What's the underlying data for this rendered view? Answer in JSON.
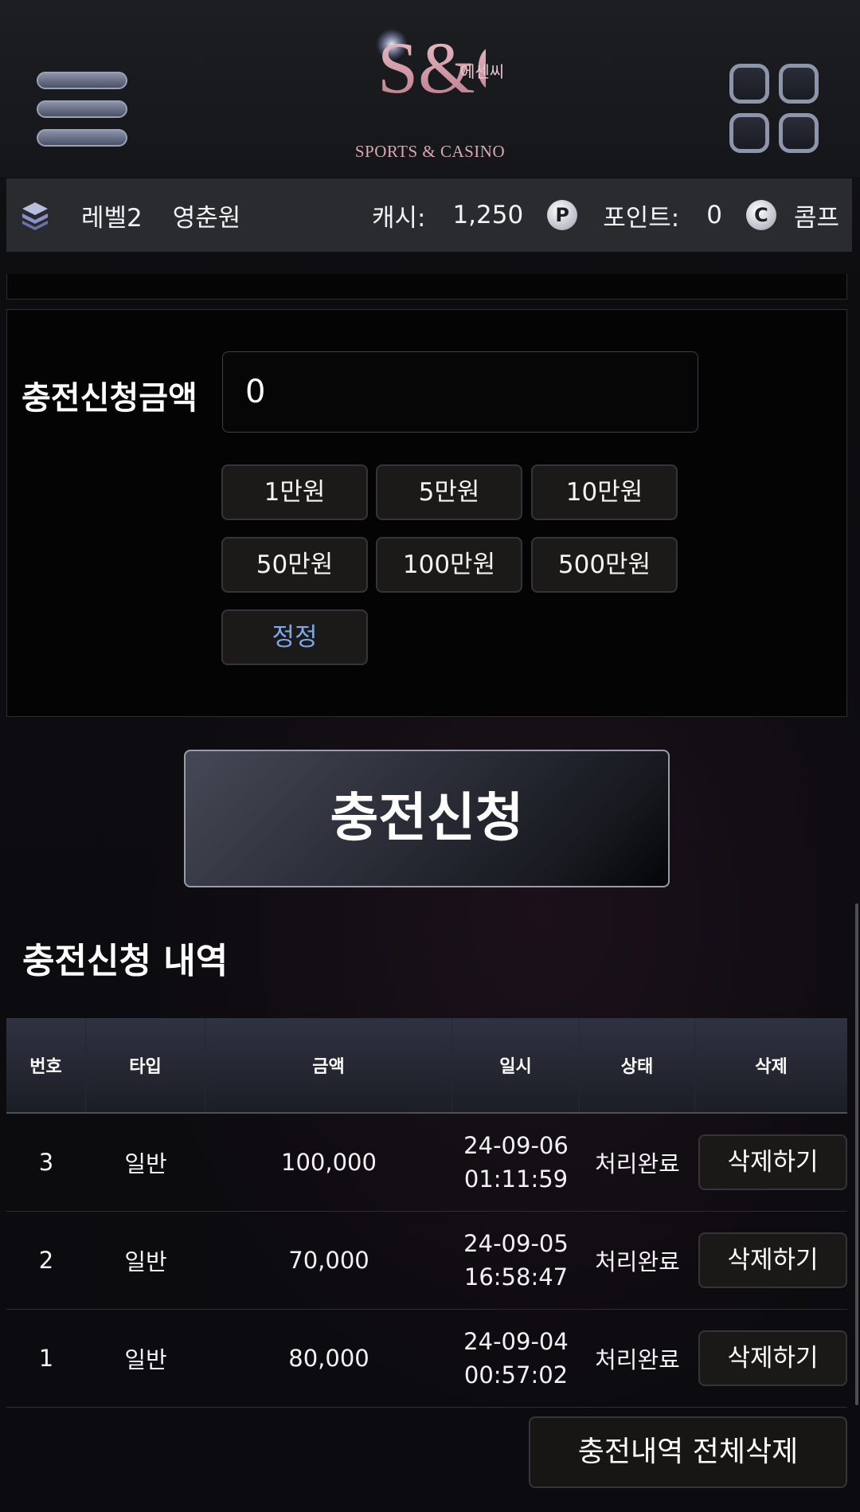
{
  "header": {
    "logo_monogram": "S&C",
    "logo_korean": "에센씨",
    "logo_text": "SPORTS & CASINO"
  },
  "infobar": {
    "level": "레벨2",
    "username": "영춘원",
    "cash_label": "캐시:",
    "cash_value": "1,250",
    "point_icon": "P",
    "point_label": "포인트:",
    "point_value": "0",
    "comp_icon": "C",
    "comp_label": "콤프"
  },
  "deposit_form": {
    "label": "충전신청금액",
    "amount_value": "0",
    "quick_amounts": [
      "1만원",
      "5만원",
      "10만원",
      "50만원",
      "100만원",
      "500만원"
    ],
    "reset_label": "정정"
  },
  "submit_label": "충전신청",
  "history": {
    "title": "충전신청 내역",
    "columns": [
      "번호",
      "타입",
      "금액",
      "일시",
      "상태",
      "삭제"
    ],
    "rows": [
      {
        "no": "3",
        "type": "일반",
        "amount": "100,000",
        "date": "24-09-06",
        "time": "01:11:59",
        "status": "처리완료",
        "delete_label": "삭제하기"
      },
      {
        "no": "2",
        "type": "일반",
        "amount": "70,000",
        "date": "24-09-05",
        "time": "16:58:47",
        "status": "처리완료",
        "delete_label": "삭제하기"
      },
      {
        "no": "1",
        "type": "일반",
        "amount": "80,000",
        "date": "24-09-04",
        "time": "00:57:02",
        "status": "처리완료",
        "delete_label": "삭제하기"
      }
    ],
    "delete_all_label": "충전내역 전체삭제"
  },
  "colors": {
    "background": "#0b0b0e",
    "accent_reset": "#7da8e8",
    "logo_pink": "#d9a9b2"
  }
}
